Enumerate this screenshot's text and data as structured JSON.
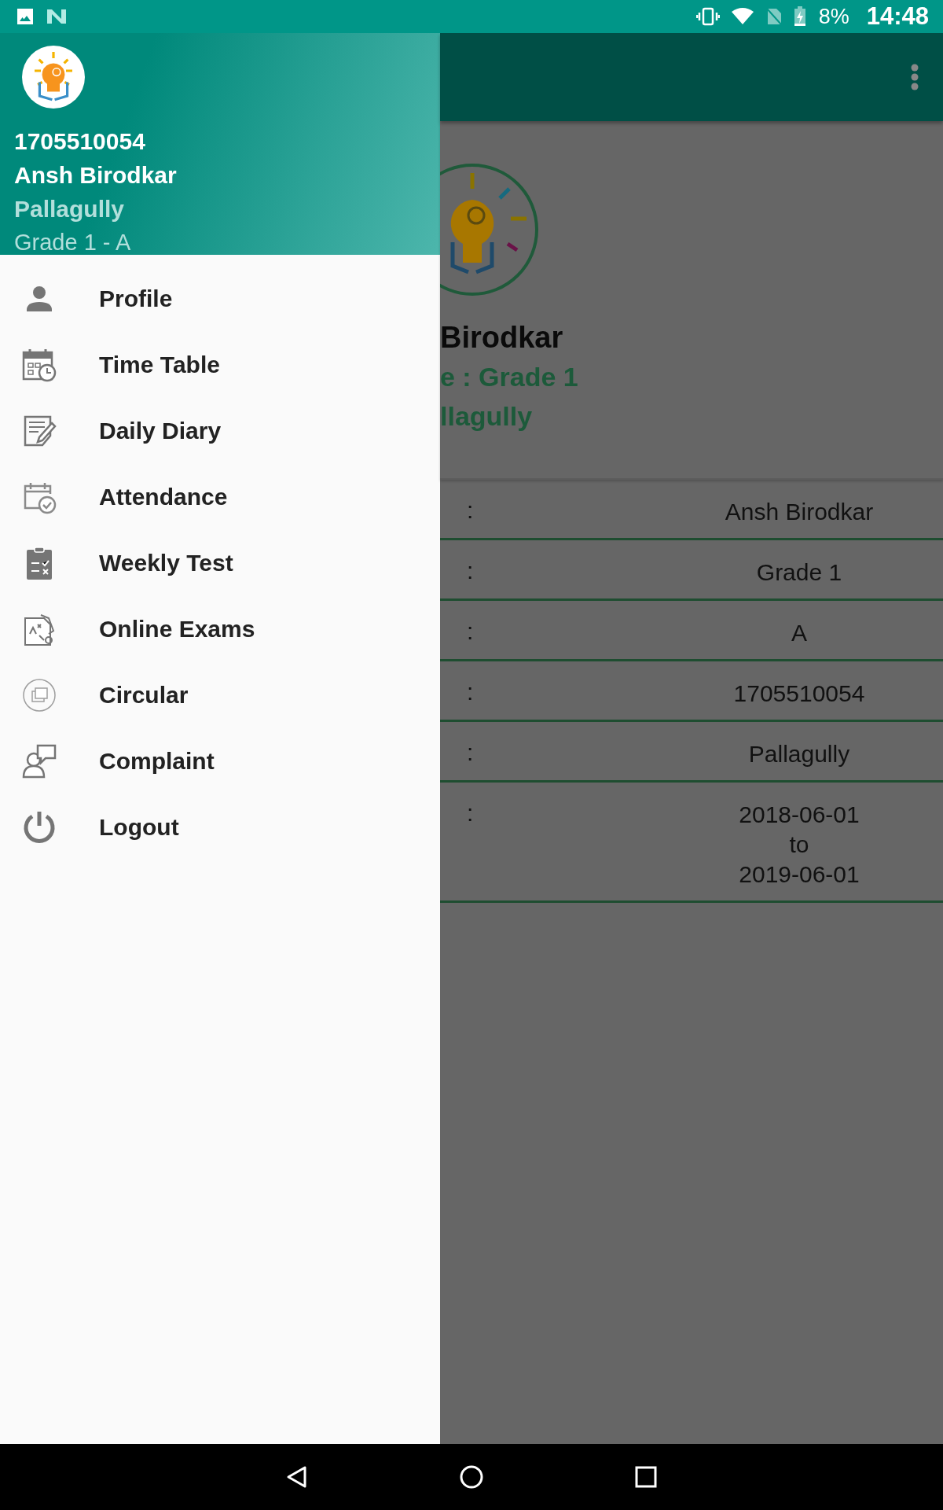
{
  "status_bar": {
    "battery": "8%",
    "time": "14:48"
  },
  "drawer": {
    "header": {
      "id": "1705510054",
      "name": "Ansh Birodkar",
      "school": "Pallagully",
      "class": "Grade 1 - A"
    },
    "items": [
      {
        "label": "Profile"
      },
      {
        "label": "Time Table"
      },
      {
        "label": "Daily Diary"
      },
      {
        "label": "Attendance"
      },
      {
        "label": "Weekly Test"
      },
      {
        "label": "Online Exams"
      },
      {
        "label": "Circular"
      },
      {
        "label": "Complaint"
      },
      {
        "label": "Logout"
      }
    ]
  },
  "background": {
    "profile": {
      "name": "Birodkar",
      "class": "e : Grade 1",
      "school": "llagully"
    },
    "rows": [
      {
        "separator": ":",
        "value": [
          "Ansh Birodkar"
        ]
      },
      {
        "separator": ":",
        "value": [
          "Grade 1"
        ]
      },
      {
        "separator": ":",
        "value": [
          "A"
        ]
      },
      {
        "separator": ":",
        "value": [
          "1705510054"
        ]
      },
      {
        "separator": ":",
        "value": [
          "Pallagully"
        ]
      },
      {
        "separator": ":",
        "value": [
          "2018-06-01",
          "to",
          "2019-06-01"
        ]
      }
    ]
  }
}
